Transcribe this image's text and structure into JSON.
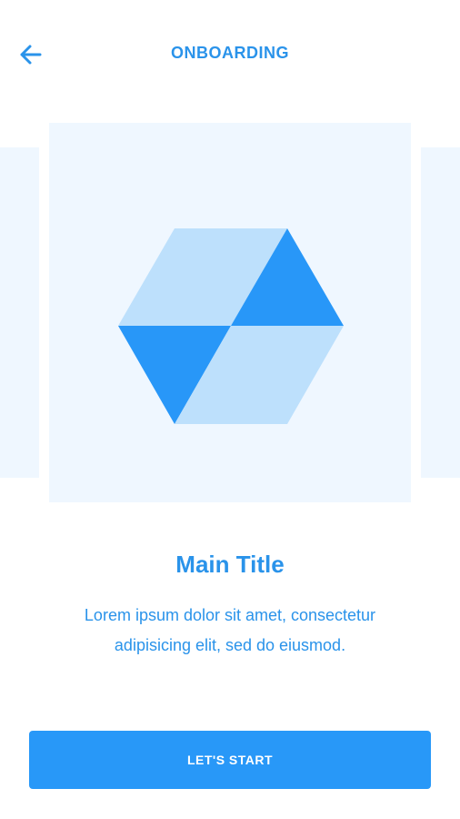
{
  "header": {
    "back_icon": "arrow-left-icon",
    "title": "ONBOARDING"
  },
  "slide": {
    "illustration_icon": "hexagon-cube-icon"
  },
  "content": {
    "title": "Main Title",
    "description": "Lorem ipsum dolor sit amet, consectetur adipisicing elit, sed do eiusmod."
  },
  "cta": {
    "label": "LET'S START"
  },
  "colors": {
    "accent": "#2a93ea",
    "button": "#2898f8",
    "slide_bg": "#eff7ff",
    "shape_light": "#bde0fc",
    "shape_dark": "#2897f8"
  }
}
